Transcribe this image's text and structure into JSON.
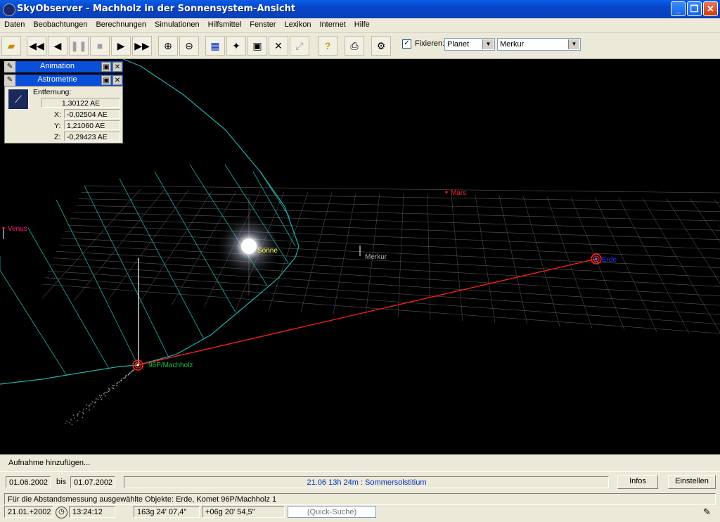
{
  "window": {
    "title": "SkyObserver - Machholz in der Sonnensystem-Ansicht"
  },
  "menu": [
    "Daten",
    "Beobachtungen",
    "Berechnungen",
    "Simulationen",
    "Hilfsmittel",
    "Fenster",
    "Lexikon",
    "Internet",
    "Hilfe"
  ],
  "toolbar": {
    "fix_label": "Fixieren:",
    "fix_checked": "✓",
    "type_value": "Planet",
    "object_value": "Merkur"
  },
  "panels": {
    "animation_title": "Animation",
    "astrometrie_title": "Astrometrie",
    "distance_label": "Entfernung:",
    "distance_value": "1,30122 AE",
    "x_label": "X:",
    "x_value": "-0,02504 AE",
    "y_label": "Y:",
    "y_value": "1,21060 AE",
    "z_label": "Z:",
    "z_value": "-0,29423 AE"
  },
  "scene": {
    "sun": "Sonne",
    "mars": "Mars",
    "venus": "Venus",
    "mercury": "Merkur",
    "earth": "Erde",
    "comet": "96P/Machholz",
    "colors": {
      "sun": "#ffff40",
      "mars": "#ff2020",
      "venus": "#ff2080",
      "mercury": "#b0b0b0",
      "earth": "#2040ff",
      "comet": "#20c040",
      "orbit": "#20b0b0",
      "grid": "#808080",
      "line": "#ff2020"
    }
  },
  "status": {
    "record_label": "Aufnahme hinzufügen...",
    "date_from": "01.06.2002",
    "bis_label": "bis",
    "date_to": "01.07.2002",
    "event_text": "21.06  13h 24m :  Sommersolstitium",
    "infos_button": "Infos",
    "settings_button": "Einstellen",
    "selection_text": "Für die Abstandsmessung ausgewählte Objekte: Erde, Komet 96P/Machholz 1",
    "timezone": "21.01.+2002",
    "time": "13:24:12",
    "ra": "163g 24' 07,4\"",
    "dec": "+06g 20' 54,5''",
    "quick_search_placeholder": "(Quick-Suche)"
  }
}
